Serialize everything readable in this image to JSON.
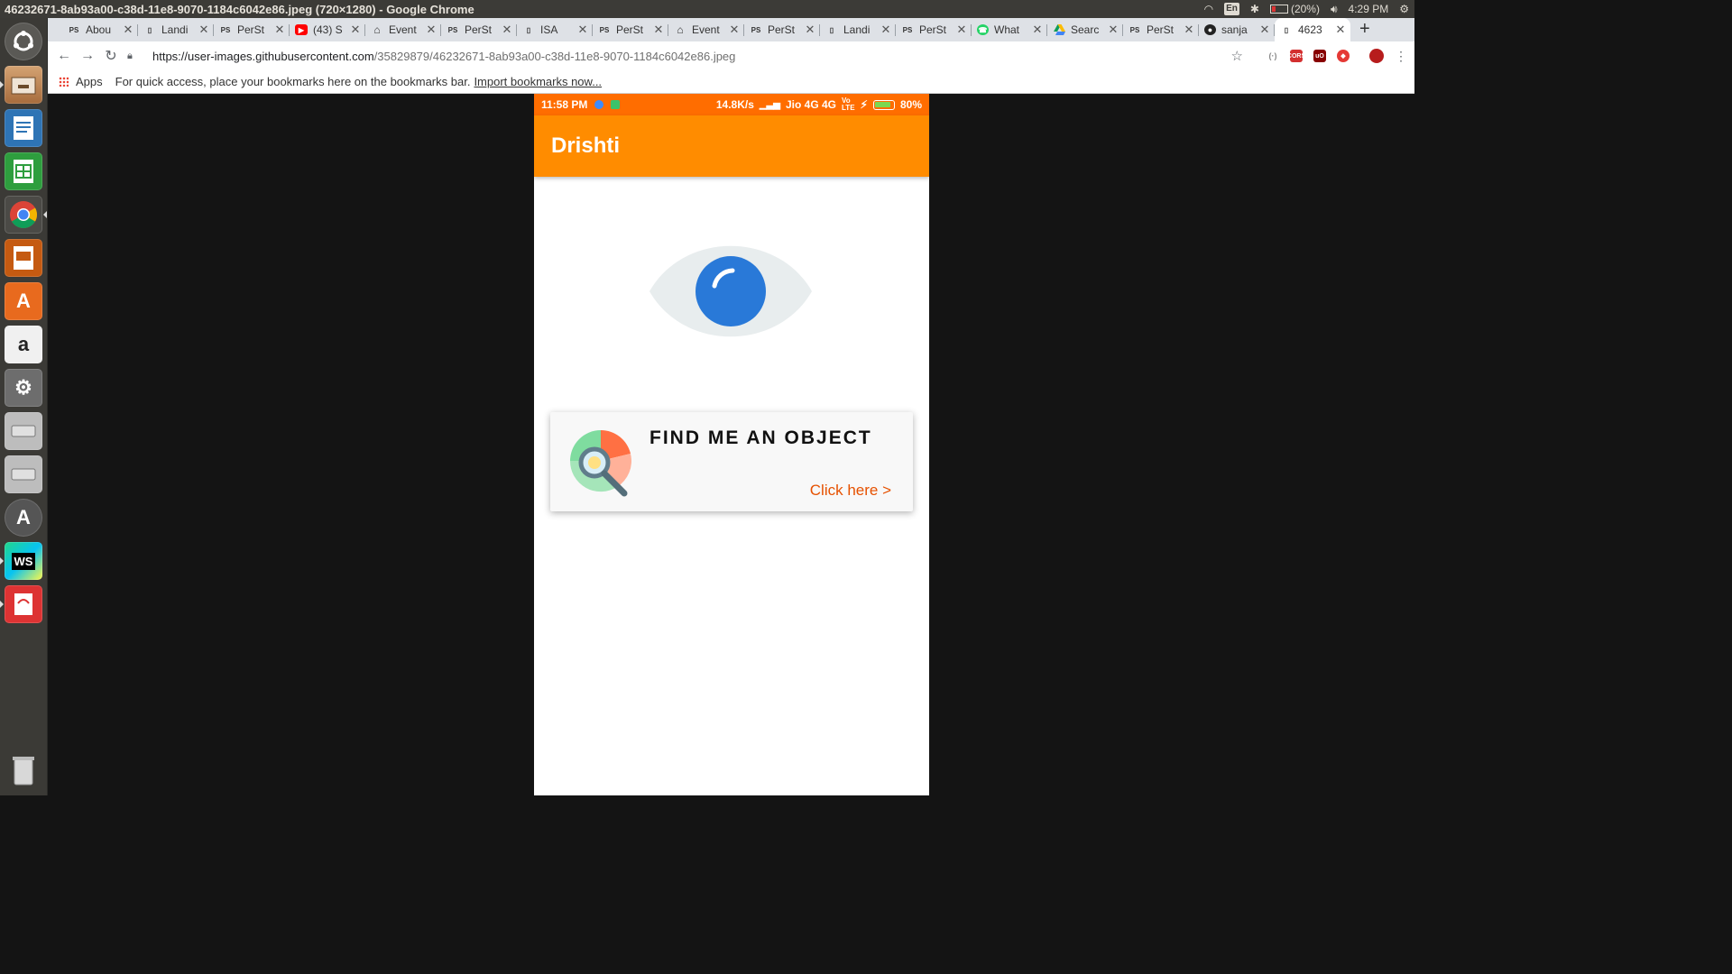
{
  "system": {
    "window_title": "46232671-8ab93a00-c38d-11e8-9070-1184c6042e86.jpeg (720×1280) - Google Chrome",
    "keyboard_layout": "En",
    "battery_text": "(20%)",
    "clock": "4:29 PM"
  },
  "browser": {
    "tabs": [
      {
        "favicon": "PS",
        "title": "Abou"
      },
      {
        "favicon": "page",
        "title": "Landi"
      },
      {
        "favicon": "PS",
        "title": "PerSt"
      },
      {
        "favicon": "youtube",
        "title": "(43) S"
      },
      {
        "favicon": "home",
        "title": "Event"
      },
      {
        "favicon": "PS",
        "title": "PerSt"
      },
      {
        "favicon": "page",
        "title": "ISA"
      },
      {
        "favicon": "PS",
        "title": "PerSt"
      },
      {
        "favicon": "home",
        "title": "Event"
      },
      {
        "favicon": "PS",
        "title": "PerSt"
      },
      {
        "favicon": "page",
        "title": "Landi"
      },
      {
        "favicon": "PS",
        "title": "PerSt"
      },
      {
        "favicon": "whatsapp",
        "title": "What"
      },
      {
        "favicon": "drive",
        "title": "Searc"
      },
      {
        "favicon": "PS",
        "title": "PerSt"
      },
      {
        "favicon": "github",
        "title": "sanja"
      },
      {
        "favicon": "page",
        "title": "4623"
      }
    ],
    "url_host": "https://user-images.githubusercontent.com",
    "url_path": "/35829879/46232671-8ab93a00-c38d-11e8-9070-1184c6042e86.jpeg",
    "bookmarks_apps": "Apps",
    "bookmarks_hint": "For quick access, place your bookmarks here on the bookmarks bar.",
    "bookmarks_import": "Import bookmarks now..."
  },
  "phone": {
    "status_time": "11:58 PM",
    "status_speed": "14.8K/s",
    "status_carrier": "Jio 4G 4G",
    "status_battery": "80%",
    "app_title": "Drishti",
    "card_title": "FIND ME AN OBJECT",
    "card_link": "Click here >"
  },
  "colors": {
    "status_bar": "#ff6d00",
    "app_bar": "#ff8c00",
    "accent_link": "#e65100",
    "eye_iris": "#2979d8",
    "eye_sclera": "#e8edee"
  }
}
